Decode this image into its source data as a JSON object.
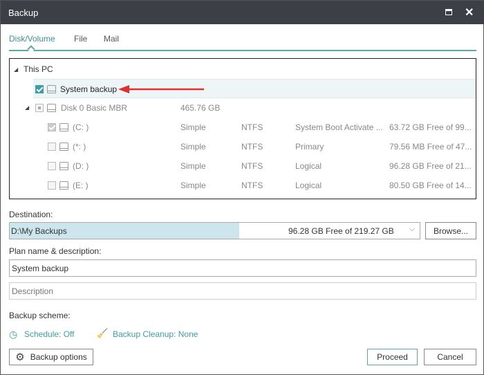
{
  "window": {
    "title": "Backup"
  },
  "tabs": [
    "Disk/Volume",
    "File",
    "Mail"
  ],
  "tree": {
    "root": "This PC",
    "system_backup": "System backup",
    "disk": {
      "name": "Disk 0 Basic MBR",
      "size": "465.76 GB"
    },
    "partitions": [
      {
        "name": "(C: )",
        "type": "Simple",
        "fs": "NTFS",
        "status": "System Boot Activate ...",
        "free": "63.72 GB Free of 99...",
        "checked": true
      },
      {
        "name": "(*: )",
        "type": "Simple",
        "fs": "NTFS",
        "status": "Primary",
        "free": "79.56 MB Free of 47...",
        "checked": false
      },
      {
        "name": "(D: )",
        "type": "Simple",
        "fs": "NTFS",
        "status": "Logical",
        "free": "96.28 GB Free of 21...",
        "checked": false
      },
      {
        "name": "(E: )",
        "type": "Simple",
        "fs": "NTFS",
        "status": "Logical",
        "free": "80.50 GB Free of 14...",
        "checked": false
      }
    ]
  },
  "destination": {
    "label": "Destination:",
    "path": "D:\\My Backups",
    "free": "96.28 GB Free of 219.27 GB",
    "used_fraction": 0.56,
    "browse": "Browse..."
  },
  "plan": {
    "label": "Plan name & description:",
    "name": "System backup",
    "description_placeholder": "Description"
  },
  "scheme": {
    "label": "Backup scheme:",
    "schedule": "Schedule: Off",
    "cleanup": "Backup Cleanup: None"
  },
  "buttons": {
    "options": "Backup options",
    "proceed": "Proceed",
    "cancel": "Cancel"
  },
  "colors": {
    "accent": "#3e9ea6",
    "titlebar": "#3c4046",
    "arrow": "#e03030"
  }
}
